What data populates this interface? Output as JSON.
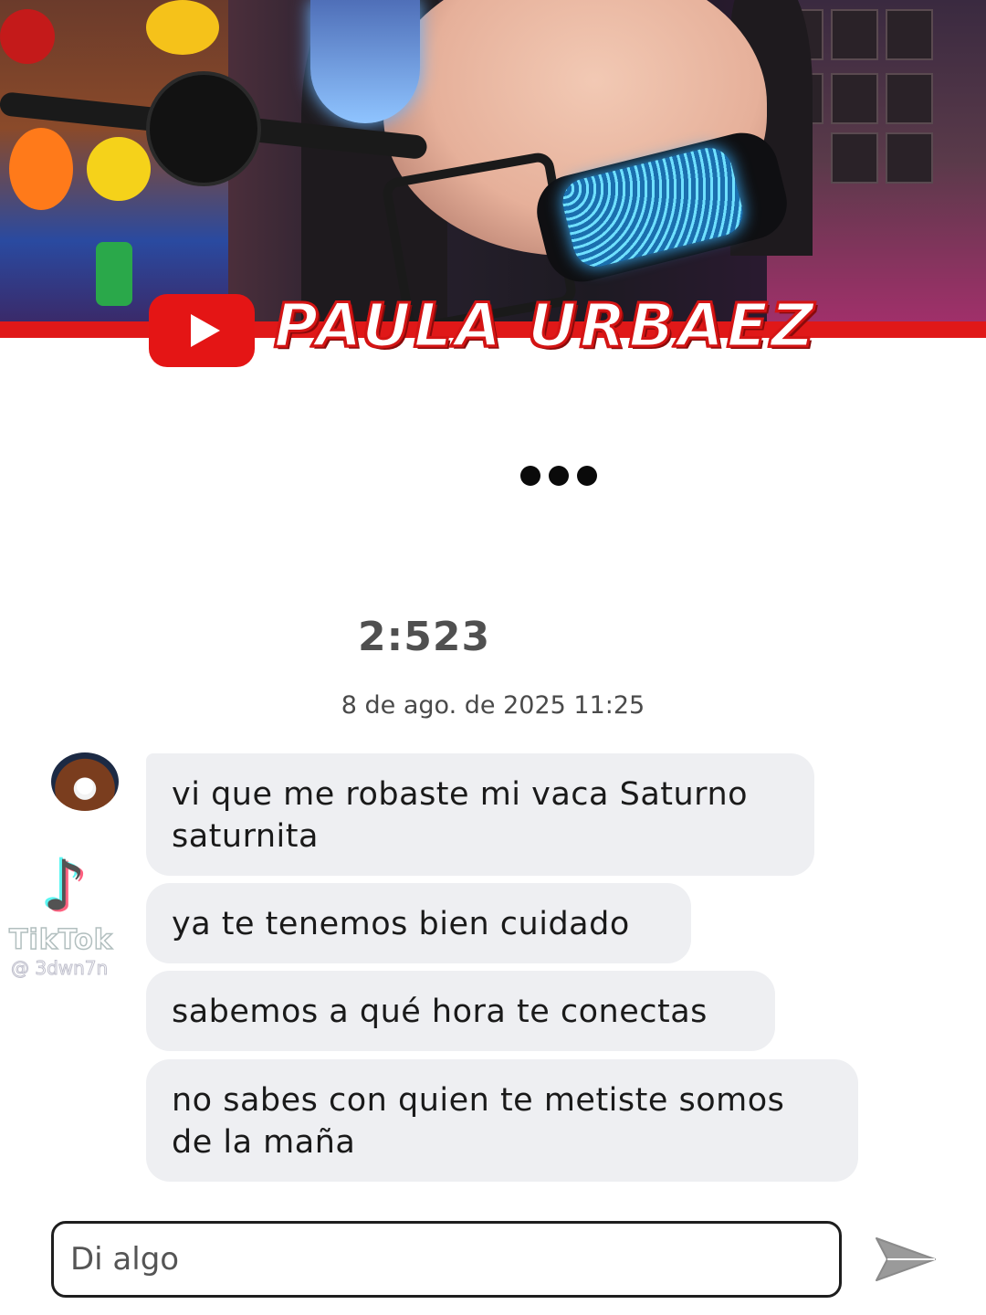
{
  "banner": {
    "channel_name": "PAULA URBAEZ",
    "logo_icon": "youtube-play-icon",
    "brand_color": "#e41515"
  },
  "chat": {
    "typing_indicator": "•••",
    "timer": "2:523",
    "date": "8 de ago. de 2025 11:25",
    "messages": [
      {
        "text": "vi que me robaste mi vaca Saturno saturnita"
      },
      {
        "text": "ya te tenemos bien cuidado"
      },
      {
        "text": "sabemos a qué hora te conectas"
      },
      {
        "text": "no sabes con quien te metiste somos de la maña"
      }
    ],
    "input": {
      "placeholder": "Di algo",
      "value": ""
    },
    "send_icon": "send-arrow-icon",
    "bubble_color": "#eeeff2"
  },
  "watermark": {
    "brand": "TikTok",
    "handle": "@ 3dwn7n"
  }
}
